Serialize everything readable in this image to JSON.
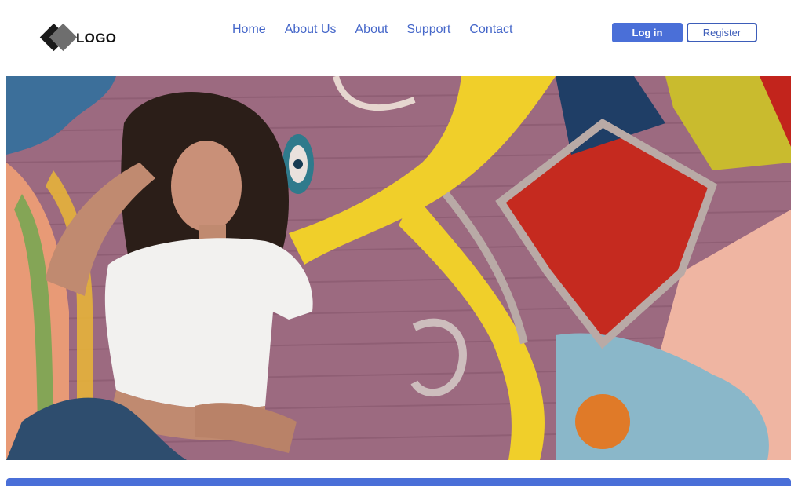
{
  "logo": {
    "text": "LOGO",
    "icon": "diamond-logo-icon"
  },
  "nav": {
    "items": [
      {
        "label": "Home"
      },
      {
        "label": "About Us"
      },
      {
        "label": "About"
      },
      {
        "label": "Support"
      },
      {
        "label": "Contact"
      }
    ]
  },
  "auth": {
    "login_label": "Log in",
    "register_label": "Register"
  },
  "hero": {
    "image": "photo of woman in white crop top leaning against colorful painted brick mural wall"
  },
  "colors": {
    "accent": "#4a6fd8",
    "nav_link": "#4466c9",
    "register_border": "#3d5db9"
  }
}
